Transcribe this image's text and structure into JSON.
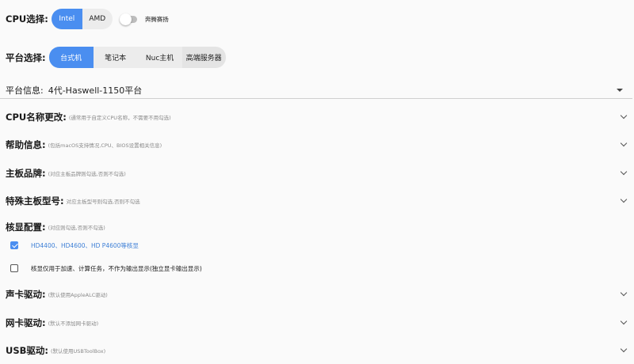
{
  "cpu": {
    "label": "CPU选择:",
    "options": [
      "Intel",
      "AMD"
    ],
    "selected": "Intel",
    "toggle_label": "奔腾赛扬",
    "toggle_on": false
  },
  "platform": {
    "label": "平台选择:",
    "options": [
      "台式机",
      "笔记本",
      "Nuc主机",
      "高端服务器"
    ],
    "selected": "台式机"
  },
  "platform_info": {
    "label": "平台信息:",
    "value": "4代-Haswell-1150平台"
  },
  "sections": [
    {
      "label": "CPU名称更改:",
      "hint": "(通常用于自定义CPU名称，不需要不用勾选)"
    },
    {
      "label": "帮助信息:",
      "hint": "(包括macOS支持情况,CPU、BIOS设置相关信息)"
    },
    {
      "label": "主板品牌:",
      "hint": "(对应主板品牌则勾选,否则不勾选)"
    },
    {
      "label": "特殊主板型号:",
      "hint": "对应主板型号则勾选,否则不勾选"
    }
  ],
  "igpu": {
    "label": "核显配置:",
    "hint": "(对应则勾选,否则不勾选)",
    "options": [
      {
        "label": "HD4400、HD4600、HD P4600等核显",
        "checked": true
      },
      {
        "label": "核显仅用于加速、计算任务，不作为输出显示(独立显卡输出显示)",
        "checked": false
      }
    ]
  },
  "drivers": [
    {
      "label": "声卡驱动:",
      "hint": "(默认使用AppleALC驱动)"
    },
    {
      "label": "网卡驱动:",
      "hint": "(默认不添加网卡驱动)"
    },
    {
      "label": "USB驱动:",
      "hint": "(默认使用USBToolBox)"
    }
  ],
  "colors": {
    "accent": "#4a8ef0",
    "background": "#fafafa",
    "inactive_segment": "#ececec"
  }
}
